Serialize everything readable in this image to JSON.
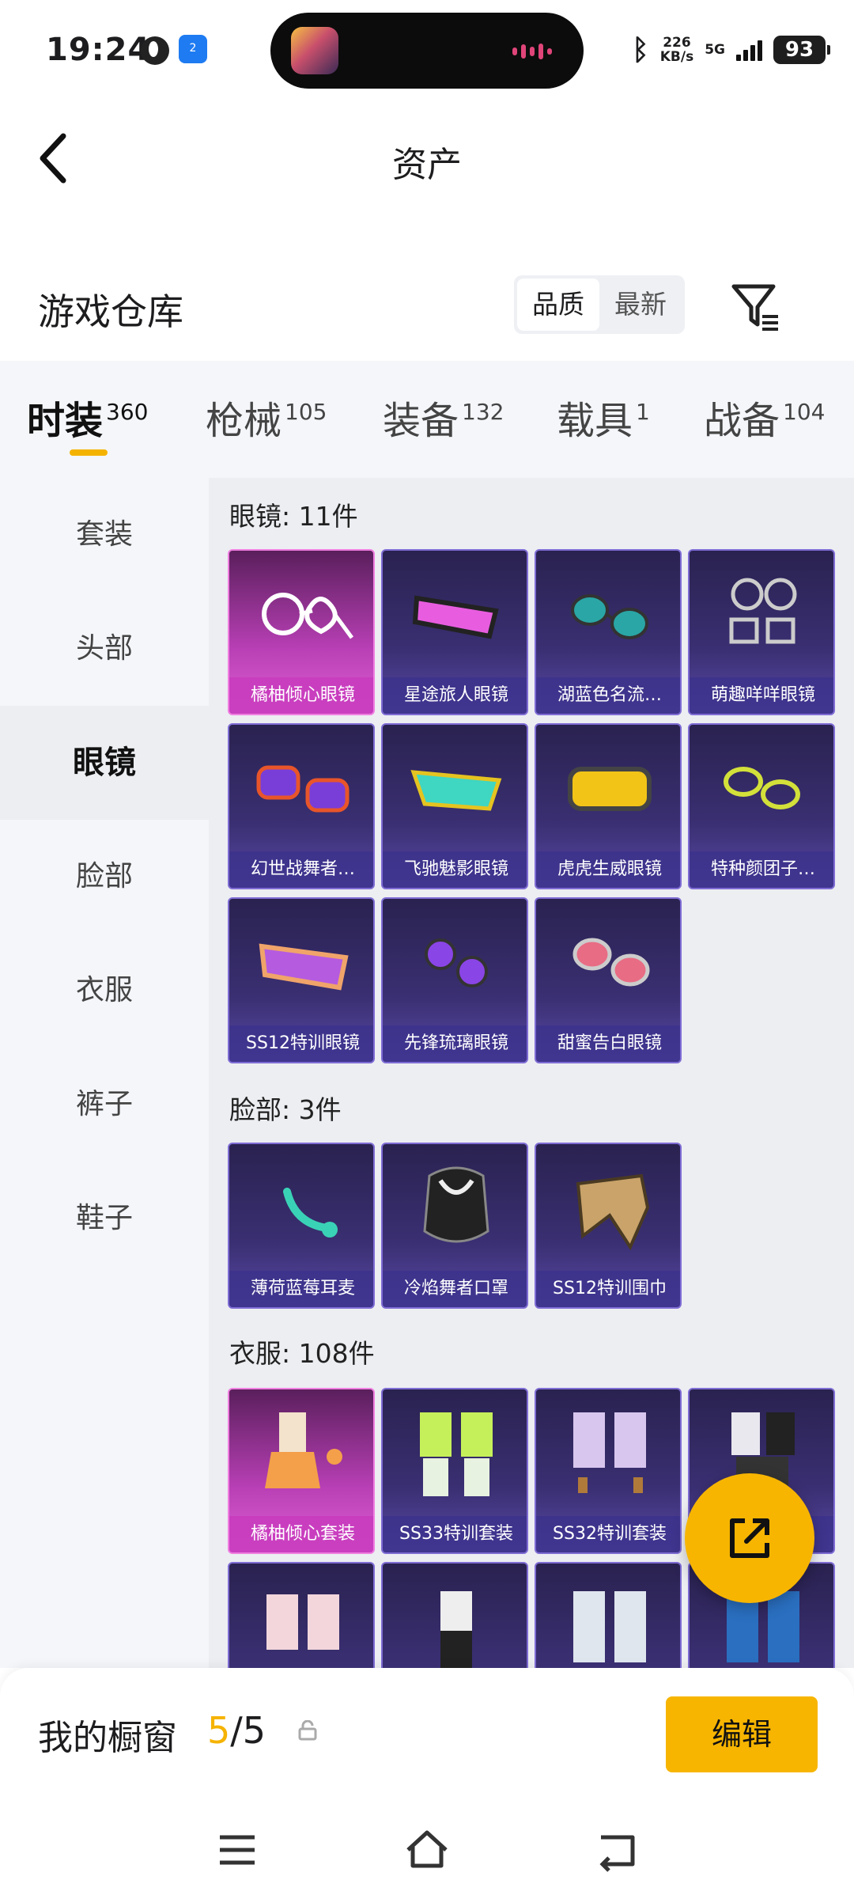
{
  "status_bar": {
    "time": "19:24",
    "app_badge": "2",
    "net_speed_value": "226",
    "net_speed_unit": "KB/s",
    "network": "5G",
    "battery": "93"
  },
  "nav": {
    "title": "资产"
  },
  "warehouse": {
    "title": "游戏仓库",
    "sort_options": [
      "品质",
      "最新"
    ]
  },
  "tabs": [
    {
      "label": "时装",
      "count": "360"
    },
    {
      "label": "枪械",
      "count": "105"
    },
    {
      "label": "装备",
      "count": "132"
    },
    {
      "label": "载具",
      "count": "1"
    },
    {
      "label": "战备",
      "count": "104"
    }
  ],
  "side_menu": [
    "套装",
    "头部",
    "眼镜",
    "脸部",
    "衣服",
    "裤子",
    "鞋子"
  ],
  "sections": [
    {
      "title": "眼镜: 11件",
      "items": [
        "橘柚倾心眼镜",
        "星途旅人眼镜",
        "湖蓝色名流…",
        "萌趣咩咩眼镜",
        "幻世战舞者…",
        "飞驰魅影眼镜",
        "虎虎生威眼镜",
        "特种颜团子…",
        "SS12特训眼镜",
        "先锋琉璃眼镜",
        "甜蜜告白眼镜"
      ]
    },
    {
      "title": "脸部: 3件",
      "items": [
        "薄荷蓝莓耳麦",
        "冷焰舞者口罩",
        "SS12特训围巾"
      ]
    },
    {
      "title": "衣服: 108件",
      "items": [
        "橘柚倾心套装",
        "SS33特训套装",
        "SS32特训套装",
        ""
      ]
    }
  ],
  "showcase": {
    "label": "我的橱窗",
    "current": "5",
    "separator": "/",
    "total": "5",
    "edit_label": "编辑"
  },
  "colors": {
    "accent": "#f7b500",
    "card_rare": "#c84fc0",
    "card_normal": "#3a2f72"
  }
}
